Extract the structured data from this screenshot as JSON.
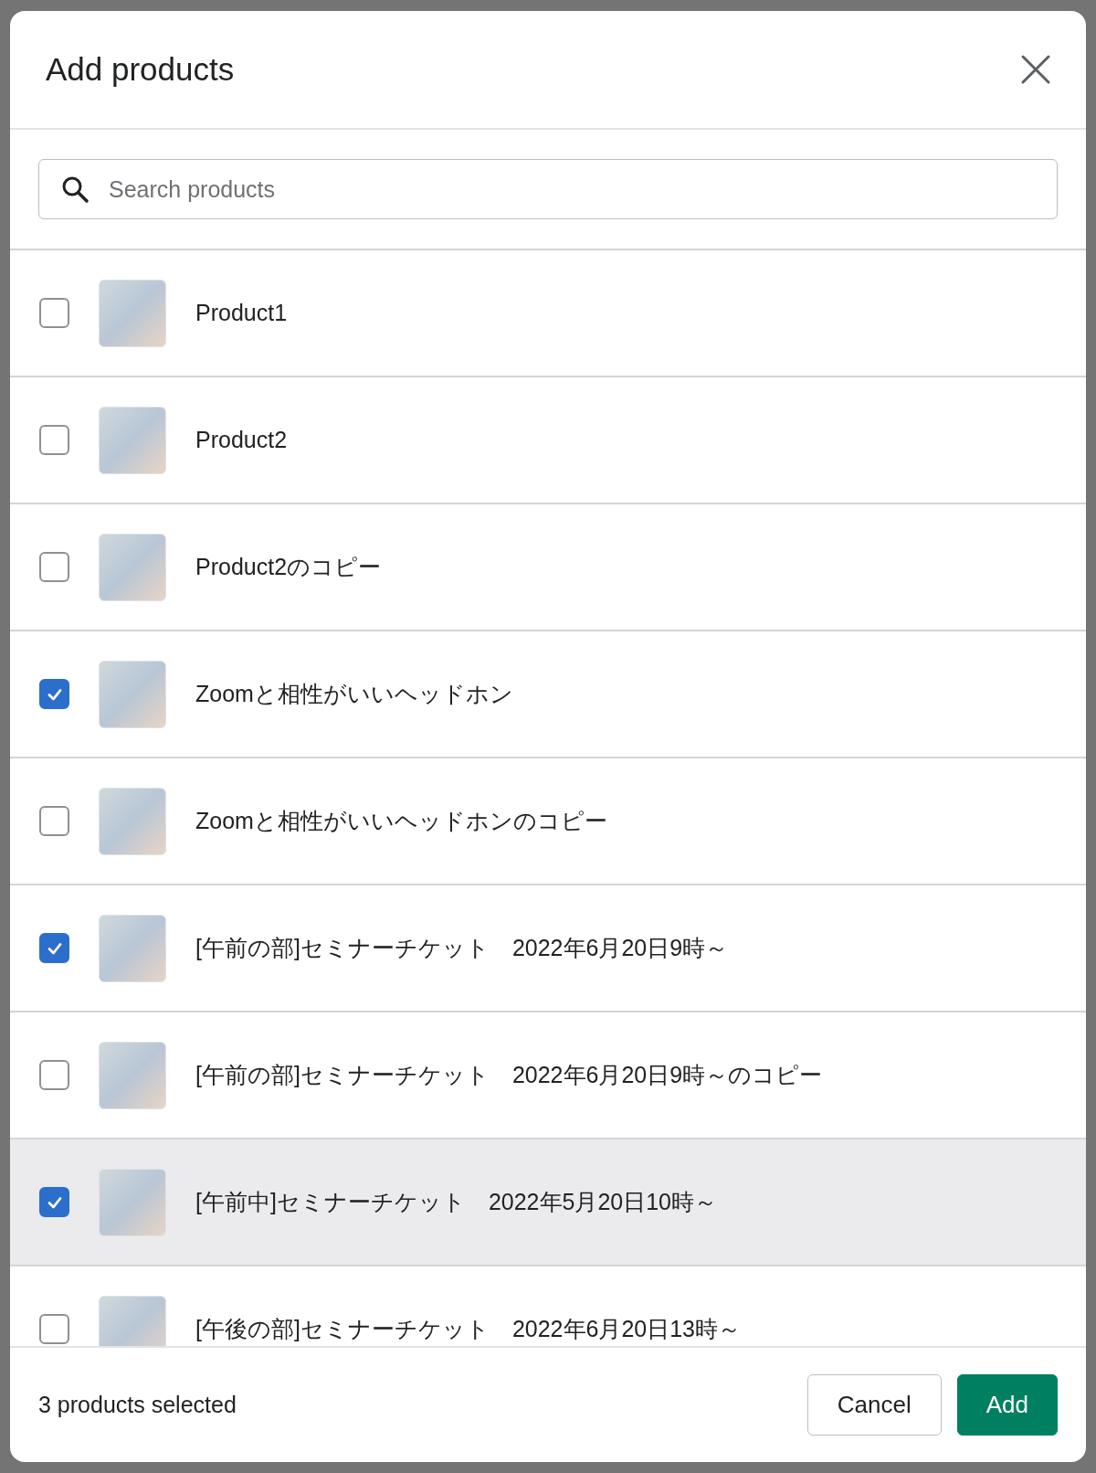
{
  "dialog": {
    "title": "Add products"
  },
  "search": {
    "placeholder": "Search products"
  },
  "products": [
    {
      "name": "Product1",
      "checked": false,
      "hovered": false
    },
    {
      "name": "Product2",
      "checked": false,
      "hovered": false
    },
    {
      "name": "Product2のコピー",
      "checked": false,
      "hovered": false
    },
    {
      "name": "Zoomと相性がいいヘッドホン",
      "checked": true,
      "hovered": false
    },
    {
      "name": "Zoomと相性がいいヘッドホンのコピー",
      "checked": false,
      "hovered": false
    },
    {
      "name": "[午前の部]セミナーチケット　2022年6月20日9時～",
      "checked": true,
      "hovered": false
    },
    {
      "name": "[午前の部]セミナーチケット　2022年6月20日9時～のコピー",
      "checked": false,
      "hovered": false
    },
    {
      "name": "[午前中]セミナーチケット　2022年5月20日10時～",
      "checked": true,
      "hovered": true
    },
    {
      "name": "[午後の部]セミナーチケット　2022年6月20日13時～",
      "checked": false,
      "hovered": false
    }
  ],
  "footer": {
    "status": "3 products selected",
    "buttons": [
      {
        "label": "Cancel",
        "kind": "secondary"
      },
      {
        "label": "Add",
        "kind": "primary"
      }
    ]
  }
}
